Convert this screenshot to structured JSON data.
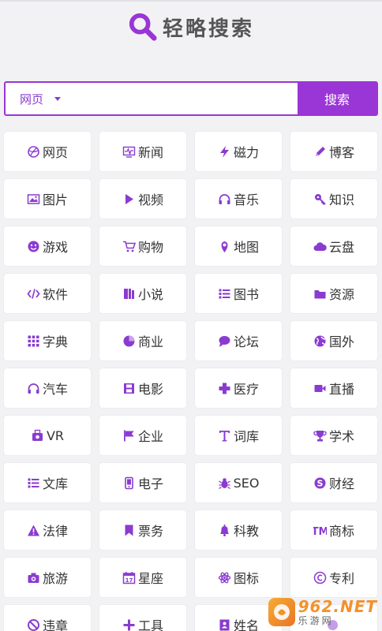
{
  "brand": {
    "title": "轻略搜索",
    "accent": "#9a35d6"
  },
  "search": {
    "engine": "网页",
    "value": "",
    "placeholder": "",
    "button_label": "搜索"
  },
  "categories": [
    {
      "label": "网页",
      "icon": "globe-icon"
    },
    {
      "label": "新闻",
      "icon": "pulse-monitor-icon"
    },
    {
      "label": "磁力",
      "icon": "lightning-icon"
    },
    {
      "label": "博客",
      "icon": "pencil-icon"
    },
    {
      "label": "图片",
      "icon": "picture-icon"
    },
    {
      "label": "视频",
      "icon": "play-icon"
    },
    {
      "label": "音乐",
      "icon": "headphones-icon"
    },
    {
      "label": "知识",
      "icon": "key-icon"
    },
    {
      "label": "游戏",
      "icon": "game-face-icon"
    },
    {
      "label": "购物",
      "icon": "cart-icon"
    },
    {
      "label": "地图",
      "icon": "map-pin-icon"
    },
    {
      "label": "云盘",
      "icon": "cloud-icon"
    },
    {
      "label": "软件",
      "icon": "code-icon"
    },
    {
      "label": "小说",
      "icon": "book-icon"
    },
    {
      "label": "图书",
      "icon": "list-icon"
    },
    {
      "label": "资源",
      "icon": "folder-icon"
    },
    {
      "label": "字典",
      "icon": "grid-dots-icon"
    },
    {
      "label": "商业",
      "icon": "pie-chart-icon"
    },
    {
      "label": "论坛",
      "icon": "chat-bubble-icon"
    },
    {
      "label": "国外",
      "icon": "earth-icon"
    },
    {
      "label": "汽车",
      "icon": "headphones-icon"
    },
    {
      "label": "电影",
      "icon": "film-icon"
    },
    {
      "label": "医疗",
      "icon": "medical-cross-icon"
    },
    {
      "label": "直播",
      "icon": "video-camera-icon"
    },
    {
      "label": "VR",
      "icon": "vr-headset-icon"
    },
    {
      "label": "企业",
      "icon": "flag-icon"
    },
    {
      "label": "词库",
      "icon": "text-icon"
    },
    {
      "label": "学术",
      "icon": "trophy-icon"
    },
    {
      "label": "文库",
      "icon": "list-icon"
    },
    {
      "label": "电子",
      "icon": "mobile-icon"
    },
    {
      "label": "SEO",
      "icon": "bug-icon"
    },
    {
      "label": "财经",
      "icon": "skype-icon"
    },
    {
      "label": "法律",
      "icon": "warning-icon"
    },
    {
      "label": "票务",
      "icon": "bookmark-icon"
    },
    {
      "label": "科教",
      "icon": "bell-icon"
    },
    {
      "label": "商标",
      "icon": "trademark-icon"
    },
    {
      "label": "旅游",
      "icon": "camera-icon"
    },
    {
      "label": "星座",
      "icon": "calendar-icon"
    },
    {
      "label": "图标",
      "icon": "atom-icon"
    },
    {
      "label": "专利",
      "icon": "copyright-icon"
    },
    {
      "label": "违章",
      "icon": "ban-icon"
    },
    {
      "label": "工具",
      "icon": "plus-icon"
    },
    {
      "label": "姓名",
      "icon": "contact-book-icon"
    },
    {
      "label": "",
      "icon": "unknown-icon"
    }
  ],
  "watermark": {
    "top": "962.NET",
    "bottom": "乐游网"
  }
}
